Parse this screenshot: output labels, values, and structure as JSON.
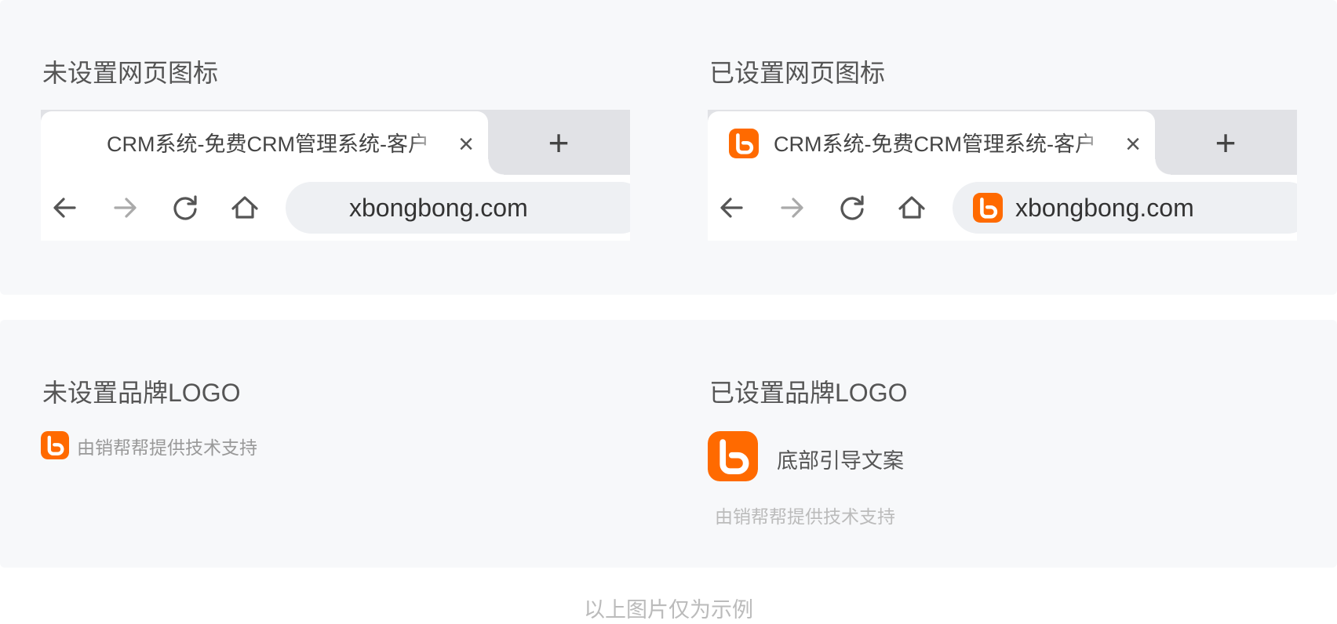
{
  "favicon_section": {
    "without": {
      "title": "未设置网页图标",
      "tab_title": "CRM系统-免费CRM管理系统-客户",
      "url": "xbongbong.com"
    },
    "with": {
      "title": "已设置网页图标",
      "tab_title": "CRM系统-免费CRM管理系统-客户",
      "url": "xbongbong.com"
    },
    "icons": {
      "tab_close": "×",
      "new_tab": "+"
    }
  },
  "logo_section": {
    "without": {
      "title": "未设置品牌LOGO",
      "support_text": "由销帮帮提供技术支持"
    },
    "with": {
      "title": "已设置品牌LOGO",
      "guide_text": "底部引导文案",
      "support_text": "由销帮帮提供技术支持"
    }
  },
  "footer_note": "以上图片仅为示例",
  "colors": {
    "brand": "#ff6a00",
    "panel_bg": "#f7f8fa",
    "tabbar_bg": "#e1e2e6",
    "muted_text": "#999999"
  },
  "icon_names": [
    "back-arrow-icon",
    "forward-arrow-icon",
    "reload-icon",
    "home-icon",
    "close-icon",
    "plus-icon",
    "brand-logo-icon"
  ]
}
